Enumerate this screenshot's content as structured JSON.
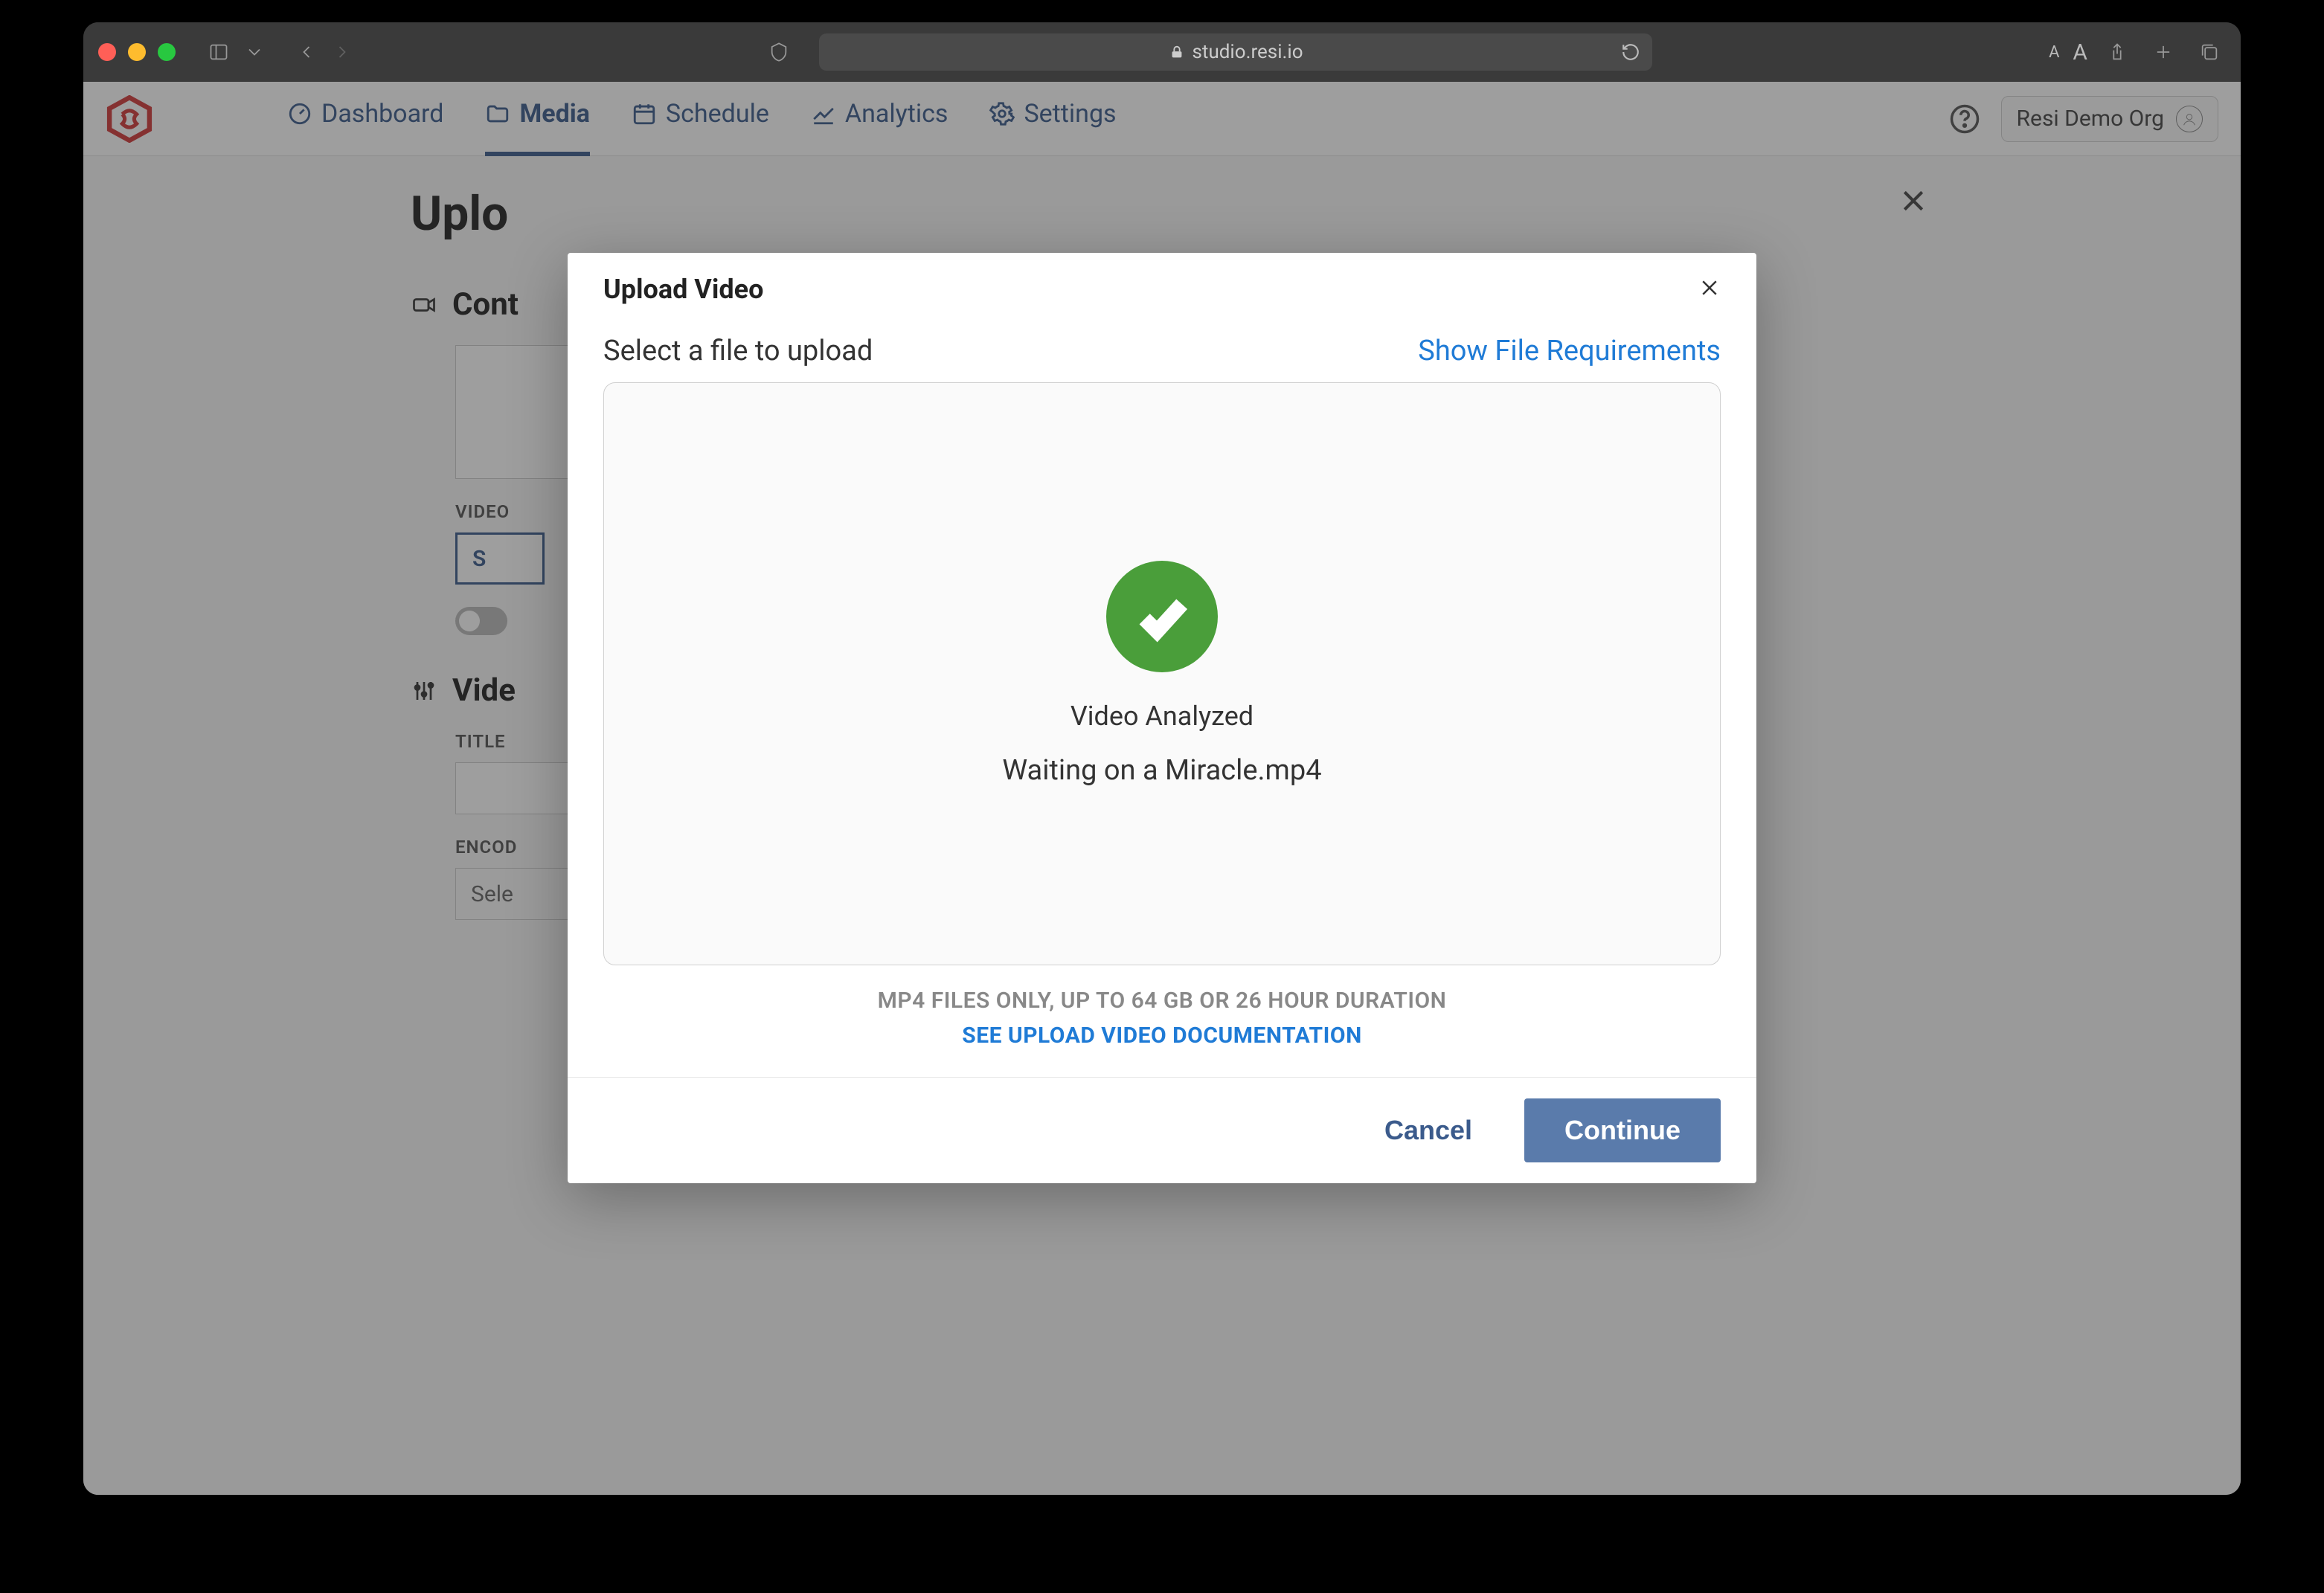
{
  "browser": {
    "url": "studio.resi.io",
    "text_size_small": "A",
    "text_size_large": "A"
  },
  "nav": {
    "items": [
      {
        "label": "Dashboard"
      },
      {
        "label": "Media"
      },
      {
        "label": "Schedule"
      },
      {
        "label": "Analytics"
      },
      {
        "label": "Settings"
      }
    ],
    "active_index": 1,
    "org": "Resi Demo Org"
  },
  "page": {
    "title": "Uplo",
    "sections": {
      "content": {
        "title": "Cont"
      },
      "video": {
        "title": "Vide"
      }
    },
    "labels": {
      "video_label_prefix": "VIDEO",
      "select_button": "S",
      "title_label": "TITLE",
      "encoder_label_prefix": "ENCOD",
      "encoder_placeholder": "Sele"
    }
  },
  "modal": {
    "title": "Upload Video",
    "select_label": "Select a file to upload",
    "show_requirements": "Show File Requirements",
    "status": "Video Analyzed",
    "filename": "Waiting on a Miracle.mp4",
    "file_hint": "MP4 FILES ONLY, UP TO 64 GB OR 26 HOUR DURATION",
    "doc_link": "SEE UPLOAD VIDEO DOCUMENTATION",
    "cancel": "Cancel",
    "continue": "Continue"
  },
  "colors": {
    "accent": "#3b5b8c",
    "link": "#1f7bd6",
    "success": "#4a9e3a"
  }
}
